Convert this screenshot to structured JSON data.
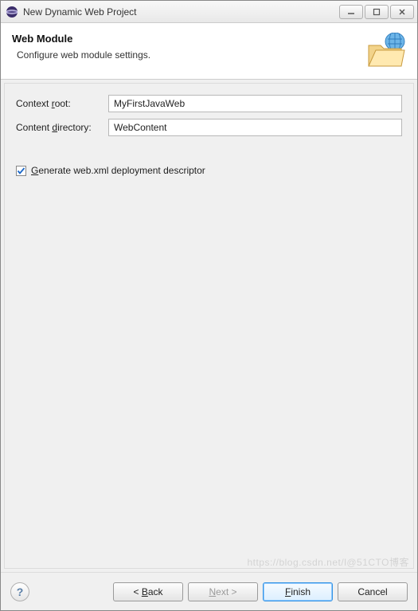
{
  "titlebar": {
    "title": "New Dynamic Web Project"
  },
  "banner": {
    "title": "Web Module",
    "subtitle": "Configure web module settings."
  },
  "fields": {
    "context_root": {
      "label_pre": "Context ",
      "label_u": "r",
      "label_post": "oot:",
      "value": "MyFirstJavaWeb"
    },
    "content_dir": {
      "label_pre": "Content ",
      "label_u": "d",
      "label_post": "irectory:",
      "value": "WebContent"
    }
  },
  "checkbox": {
    "checked": true,
    "label_u": "G",
    "label_post": "enerate web.xml deployment descriptor"
  },
  "buttons": {
    "back_pre": "< ",
    "back_u": "B",
    "back_post": "ack",
    "next_u": "N",
    "next_post": "ext >",
    "finish_u": "F",
    "finish_post": "inish",
    "cancel": "Cancel"
  },
  "watermark": "https://blog.csdn.net/l@51CTO博客"
}
